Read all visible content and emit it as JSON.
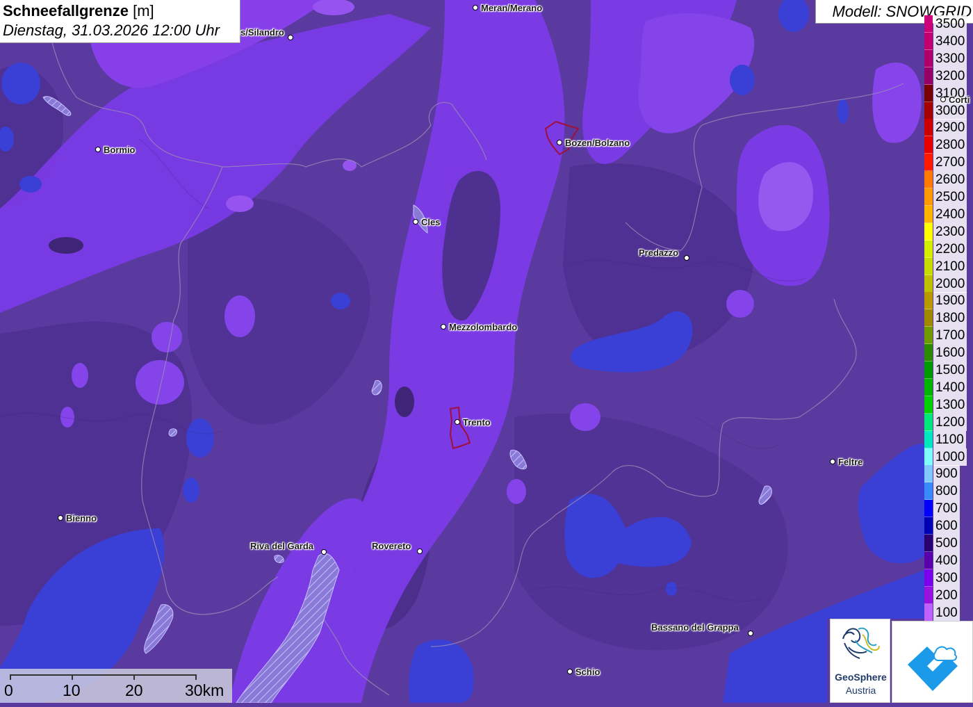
{
  "header": {
    "title_bold": "Schneefallgrenze",
    "title_unit": "[m]",
    "datetime": "Dienstag, 31.03.2026 12:00 Uhr"
  },
  "model": {
    "label": "Modell: SNOWGRID"
  },
  "legend": {
    "items": [
      {
        "label": "3500",
        "color": "#cc0077"
      },
      {
        "label": "3400",
        "color": "#c4006e"
      },
      {
        "label": "3300",
        "color": "#b0006a"
      },
      {
        "label": "3200",
        "color": "#960066"
      },
      {
        "label": "3100",
        "color": "#7a0000"
      },
      {
        "label": "3000",
        "color": "#a60000"
      },
      {
        "label": "2900",
        "color": "#cc0000"
      },
      {
        "label": "2800",
        "color": "#e60000"
      },
      {
        "label": "2700",
        "color": "#ff1a00"
      },
      {
        "label": "2600",
        "color": "#ff7a00"
      },
      {
        "label": "2500",
        "color": "#ff9a00"
      },
      {
        "label": "2400",
        "color": "#ffb400"
      },
      {
        "label": "2300",
        "color": "#ffff00"
      },
      {
        "label": "2200",
        "color": "#d4ee00"
      },
      {
        "label": "2100",
        "color": "#c8dc00"
      },
      {
        "label": "2000",
        "color": "#c0c000"
      },
      {
        "label": "1900",
        "color": "#b89a00"
      },
      {
        "label": "1800",
        "color": "#a08800"
      },
      {
        "label": "1700",
        "color": "#6f9a00"
      },
      {
        "label": "1600",
        "color": "#2a8a00"
      },
      {
        "label": "1500",
        "color": "#009a00"
      },
      {
        "label": "1400",
        "color": "#00b400"
      },
      {
        "label": "1300",
        "color": "#00d000"
      },
      {
        "label": "1200",
        "color": "#00e87a"
      },
      {
        "label": "1100",
        "color": "#00e8c0"
      },
      {
        "label": "1000",
        "color": "#80ffff"
      },
      {
        "label": "900",
        "color": "#80c8ff"
      },
      {
        "label": "800",
        "color": "#3a8aff"
      },
      {
        "label": "700",
        "color": "#0000ff"
      },
      {
        "label": "600",
        "color": "#0000b4"
      },
      {
        "label": "500",
        "color": "#2a0070"
      },
      {
        "label": "400",
        "color": "#5a00aa"
      },
      {
        "label": "300",
        "color": "#7a00ee"
      },
      {
        "label": "200",
        "color": "#9a10e0"
      },
      {
        "label": "100",
        "color": "#c060ff"
      }
    ]
  },
  "cities": [
    {
      "name": "Meran/Merano"
    },
    {
      "name": "s/Silandro"
    },
    {
      "name": "Bormio"
    },
    {
      "name": "Bozen/Bolzano"
    },
    {
      "name": "Cles"
    },
    {
      "name": "Predazzo"
    },
    {
      "name": "Mezzolombardo"
    },
    {
      "name": "Trento"
    },
    {
      "name": "Feltre"
    },
    {
      "name": "Bienno"
    },
    {
      "name": "Riva del Garda"
    },
    {
      "name": "Rovereto"
    },
    {
      "name": "Bassano del Grappa"
    },
    {
      "name": "Schio"
    },
    {
      "name": "Corti"
    }
  ],
  "scalebar": {
    "labels": [
      "0",
      "10",
      "20",
      "30km"
    ]
  },
  "logos": {
    "geosphere_line1": "GeoSphere",
    "geosphere_line2": "Austria"
  },
  "colors": {
    "base": "#5a3a9e",
    "dark_purple": "#4a2e86",
    "violet": "#7f3ef0",
    "light_violet": "#9a55f5",
    "blue": "#3a40d8"
  }
}
